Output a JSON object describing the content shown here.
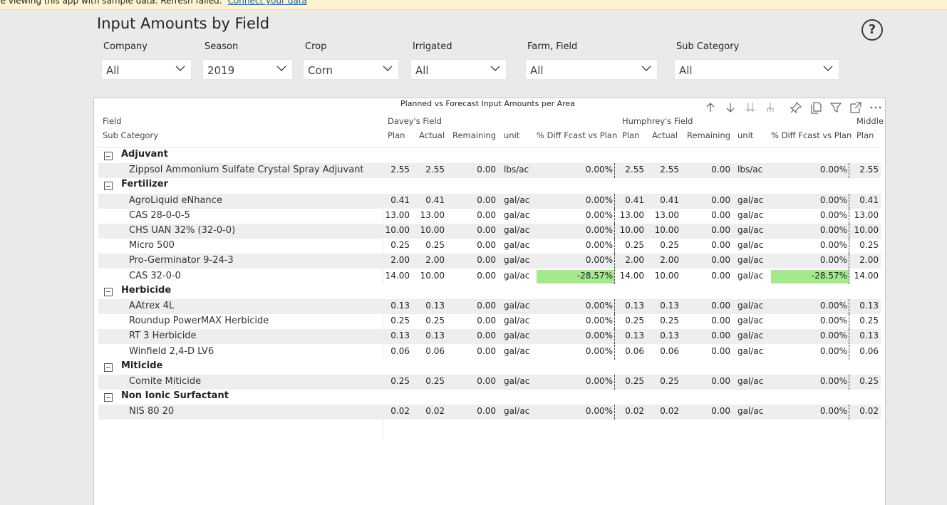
{
  "banner": {
    "text": "re viewing this app with sample data. Refresh failed.",
    "link": "Connect your data"
  },
  "page_title": "Input Amounts by Field",
  "help_icon": "question-circle-icon",
  "slicers": [
    {
      "label": "Company",
      "value": "All"
    },
    {
      "label": "Season",
      "value": "2019"
    },
    {
      "label": "Crop",
      "value": "Corn"
    },
    {
      "label": "Irrigated",
      "value": "All"
    },
    {
      "label": "Farm, Field",
      "value": "All"
    },
    {
      "label": "Sub Category",
      "value": "All"
    }
  ],
  "visual": {
    "title": "Planned vs Forecast Input Amounts per Area",
    "icons": [
      "sort-up-icon",
      "sort-down-icon",
      "expand-all-icon",
      "drill-down-icon",
      "pin-icon",
      "copy-icon",
      "filter-icon",
      "focus-mode-icon",
      "more-options-icon"
    ],
    "row_header_1": "Field",
    "row_header_2": "Sub Category",
    "field_groups": [
      "Davey's Field",
      "Humphrey's Field",
      "Middle"
    ],
    "measures": [
      "Plan",
      "Actual",
      "Remaining",
      "unit",
      "% Diff Fcast vs Plan"
    ],
    "highlight_color": "#a4e98e",
    "rows": [
      {
        "type": "group",
        "label": "Adjuvant"
      },
      {
        "type": "item",
        "label": "Zippsol Ammonium Sulfate Crystal Spray Adjuvant",
        "a": [
          "2.55",
          "2.55",
          "0.00",
          "lbs/ac",
          "0.00%"
        ],
        "b": [
          "2.55",
          "2.55",
          "0.00",
          "lbs/ac",
          "0.00%"
        ],
        "c": "2.55",
        "hl": false
      },
      {
        "type": "group",
        "label": "Fertilizer"
      },
      {
        "type": "item",
        "label": "AgroLiquid eNhance",
        "a": [
          "0.41",
          "0.41",
          "0.00",
          "gal/ac",
          "0.00%"
        ],
        "b": [
          "0.41",
          "0.41",
          "0.00",
          "gal/ac",
          "0.00%"
        ],
        "c": "0.41",
        "hl": false
      },
      {
        "type": "item",
        "label": "CAS 28-0-0-5",
        "a": [
          "13.00",
          "13.00",
          "0.00",
          "gal/ac",
          "0.00%"
        ],
        "b": [
          "13.00",
          "13.00",
          "0.00",
          "gal/ac",
          "0.00%"
        ],
        "c": "13.00",
        "hl": false
      },
      {
        "type": "item",
        "label": "CHS UAN 32% (32-0-0)",
        "a": [
          "10.00",
          "10.00",
          "0.00",
          "gal/ac",
          "0.00%"
        ],
        "b": [
          "10.00",
          "10.00",
          "0.00",
          "gal/ac",
          "0.00%"
        ],
        "c": "10.00",
        "hl": false
      },
      {
        "type": "item",
        "label": "Micro 500",
        "a": [
          "0.25",
          "0.25",
          "0.00",
          "gal/ac",
          "0.00%"
        ],
        "b": [
          "0.25",
          "0.25",
          "0.00",
          "gal/ac",
          "0.00%"
        ],
        "c": "0.25",
        "hl": false
      },
      {
        "type": "item",
        "label": "Pro-Germinator 9-24-3",
        "a": [
          "2.00",
          "2.00",
          "0.00",
          "gal/ac",
          "0.00%"
        ],
        "b": [
          "2.00",
          "2.00",
          "0.00",
          "gal/ac",
          "0.00%"
        ],
        "c": "2.00",
        "hl": false
      },
      {
        "type": "item",
        "label": "CAS 32-0-0",
        "a": [
          "14.00",
          "10.00",
          "0.00",
          "gal/ac",
          "-28.57%"
        ],
        "b": [
          "14.00",
          "10.00",
          "0.00",
          "gal/ac",
          "-28.57%"
        ],
        "c": "14.00",
        "hl": true
      },
      {
        "type": "group",
        "label": "Herbicide"
      },
      {
        "type": "item",
        "label": "AAtrex 4L",
        "a": [
          "0.13",
          "0.13",
          "0.00",
          "gal/ac",
          "0.00%"
        ],
        "b": [
          "0.13",
          "0.13",
          "0.00",
          "gal/ac",
          "0.00%"
        ],
        "c": "0.13",
        "hl": false
      },
      {
        "type": "item",
        "label": "Roundup PowerMAX Herbicide",
        "a": [
          "0.25",
          "0.25",
          "0.00",
          "gal/ac",
          "0.00%"
        ],
        "b": [
          "0.25",
          "0.25",
          "0.00",
          "gal/ac",
          "0.00%"
        ],
        "c": "0.25",
        "hl": false
      },
      {
        "type": "item",
        "label": "RT 3 Herbicide",
        "a": [
          "0.13",
          "0.13",
          "0.00",
          "gal/ac",
          "0.00%"
        ],
        "b": [
          "0.13",
          "0.13",
          "0.00",
          "gal/ac",
          "0.00%"
        ],
        "c": "0.13",
        "hl": false
      },
      {
        "type": "item",
        "label": "Winfield 2,4-D LV6",
        "a": [
          "0.06",
          "0.06",
          "0.00",
          "gal/ac",
          "0.00%"
        ],
        "b": [
          "0.06",
          "0.06",
          "0.00",
          "gal/ac",
          "0.00%"
        ],
        "c": "0.06",
        "hl": false
      },
      {
        "type": "group",
        "label": "Miticide"
      },
      {
        "type": "item",
        "label": "Comite Miticide",
        "a": [
          "0.25",
          "0.25",
          "0.00",
          "gal/ac",
          "0.00%"
        ],
        "b": [
          "0.25",
          "0.25",
          "0.00",
          "gal/ac",
          "0.00%"
        ],
        "c": "0.25",
        "hl": false
      },
      {
        "type": "group",
        "label": "Non Ionic Surfactant"
      },
      {
        "type": "item",
        "label": "NIS 80 20",
        "a": [
          "0.02",
          "0.02",
          "0.00",
          "gal/ac",
          "0.00%"
        ],
        "b": [
          "0.02",
          "0.02",
          "0.00",
          "gal/ac",
          "0.00%"
        ],
        "c": "0.02",
        "hl": false
      }
    ]
  }
}
